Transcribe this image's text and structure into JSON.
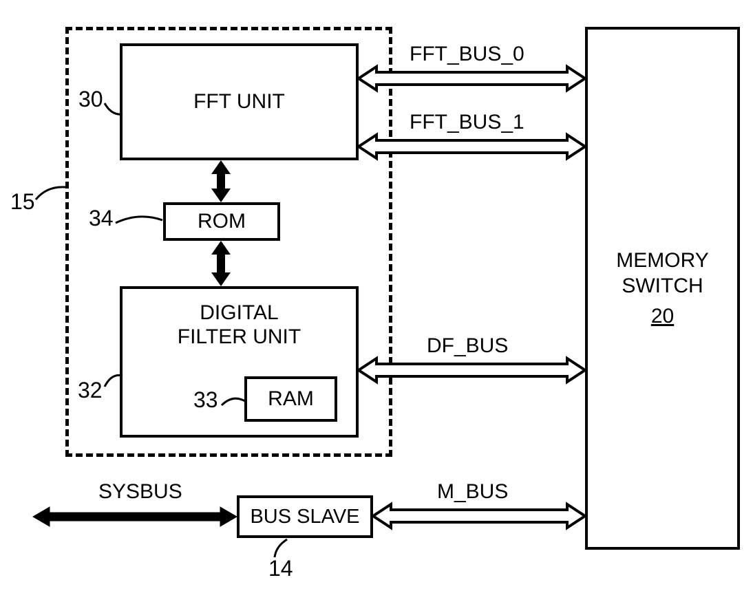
{
  "blocks": {
    "fft_unit": "FFT UNIT",
    "rom": "ROM",
    "digital_filter": "DIGITAL\nFILTER UNIT",
    "ram": "RAM",
    "bus_slave": "BUS SLAVE",
    "memory_switch_line1": "MEMORY",
    "memory_switch_line2": "SWITCH",
    "memory_switch_ref": "20"
  },
  "buses": {
    "fft_bus_0": "FFT_BUS_0",
    "fft_bus_1": "FFT_BUS_1",
    "df_bus": "DF_BUS",
    "m_bus": "M_BUS",
    "sysbus": "SYSBUS"
  },
  "refs": {
    "group": "15",
    "fft_unit": "30",
    "rom": "34",
    "digital_filter": "32",
    "ram": "33",
    "bus_slave": "14"
  }
}
